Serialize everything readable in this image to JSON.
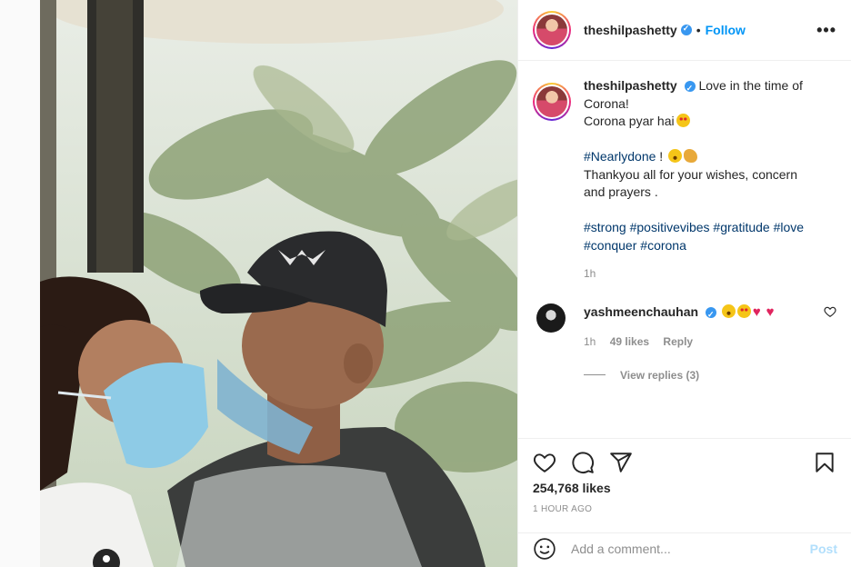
{
  "post": {
    "username": "theshilpashetty",
    "follow_label": "Follow",
    "dot": "•",
    "more_label": "•••"
  },
  "caption": {
    "username": "theshilpashetty",
    "line1": "Love in the time of Corona!",
    "line2": "Corona pyar hai",
    "hashtag1": "#Nearlydone",
    "after_hashtag1": " ! ",
    "line4": "Thankyou all for your wishes, concern and prayers .",
    "hashtags": [
      "#strong",
      "#positivevibes",
      "#gratitude",
      "#love",
      "#conquer",
      "#corona"
    ],
    "time": "1h"
  },
  "reply": {
    "username": "yashmeenchauhan",
    "time": "1h",
    "likes": "49 likes",
    "reply_label": "Reply",
    "view_replies": "View replies (3)"
  },
  "engagement": {
    "likes": "254,768 likes",
    "posted_ago": "1 HOUR AGO"
  },
  "comment_box": {
    "placeholder": "Add a comment...",
    "post_label": "Post"
  },
  "icons": [
    "verified-badge-icon",
    "more-icon",
    "heart-icon",
    "comment-icon",
    "share-icon",
    "save-icon",
    "emoji-icon",
    "user-tag-icon"
  ],
  "colors": {
    "link_blue": "#0095f6",
    "hashtag": "#00376b",
    "muted": "#8e8e8e",
    "post_disabled": "#b2dffc"
  }
}
